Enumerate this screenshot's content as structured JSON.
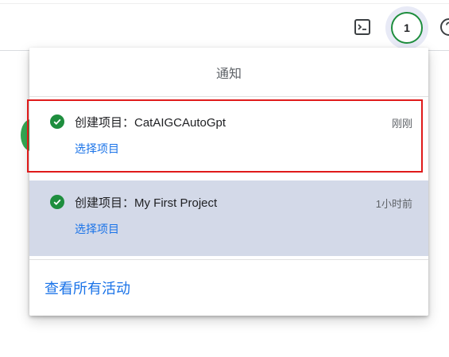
{
  "header": {
    "terminal_icon": "terminal-icon",
    "notification_count": "1",
    "help_icon": "help-icon"
  },
  "notifications": {
    "title": "通知",
    "items": [
      {
        "icon": "check-circle-icon",
        "message": "创建项目：CatAIGCAutoGpt",
        "time": "刚刚",
        "action": "选择项目"
      },
      {
        "icon": "check-circle-icon",
        "message": "创建项目：My First Project",
        "time": "1小时前",
        "action": "选择项目"
      }
    ],
    "view_all": "查看所有活动"
  },
  "colors": {
    "success": "#1e8e3e",
    "link": "#1a73e8",
    "highlight_border": "#e01b1b",
    "hover_row": "#d3d9e8"
  }
}
